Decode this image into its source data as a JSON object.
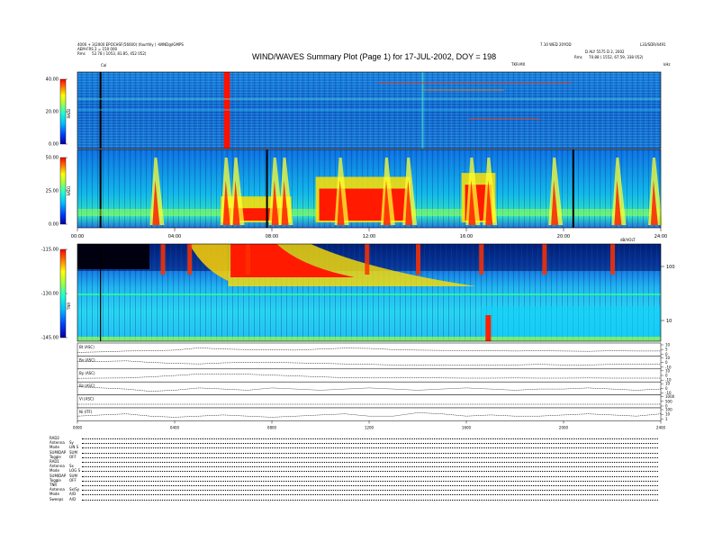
{
  "header": {
    "left_line1": "4000 + 3(2000 EPOCHSF(56000) (fourthly ) -WIND@IGMPS",
    "left_line2": "AEM-FRS 2 = 150 000",
    "left_rms_label": "Rms",
    "left_rms_value": "52.78 ( 1053, 81.85, 452 052)",
    "title": "WIND/WAVES Summary Plot (Page 1) for 17-JUL-2002, DOY = 198",
    "right_line1": "7.10 WED 20YOD",
    "right_corner": "L33/SDR/4491",
    "right_line2": "D ALY 5575 D 2, 2002",
    "right_rms_label": "Rms",
    "right_rms_value": "70.88 ( 1552, 67.59, 338 052)",
    "cal_label": "Cal",
    "thmx_label": "TKR-MX",
    "khz_label": "kHz"
  },
  "chart_data": [
    {
      "type": "heatmap",
      "panel": "RAD2",
      "ylabel": "RAD2",
      "colorbar_ticks": [
        "40.00",
        "20.00",
        "0.00"
      ],
      "colorbar_range": [
        0,
        40
      ],
      "colormap": [
        "#0000a0",
        "#0040ff",
        "#00c0ff",
        "#20ffd0",
        "#a0ff40",
        "#ffff00",
        "#ff8000",
        "#ff0000"
      ],
      "events_hours": [
        6.1,
        6.2,
        14.2
      ],
      "cal_hour": 0.95
    },
    {
      "type": "heatmap",
      "panel": "RAD1",
      "ylabel": "RAD1",
      "colorbar_ticks": [
        "50.00",
        "25.00",
        "0.00"
      ],
      "colorbar_range": [
        0,
        50
      ],
      "x_ticks": [
        "00:00",
        "04:00",
        "08:00",
        "12:00",
        "16:00",
        "20:00",
        "24:00"
      ],
      "xlim_hours": [
        0,
        24
      ],
      "events_hours": [
        3.2,
        6.1,
        6.5,
        8.1,
        8.5,
        10.8,
        12.7,
        13.6,
        16.2,
        16.9,
        19.6,
        22.2,
        23.7
      ]
    },
    {
      "type": "heatmap",
      "panel": "TNR",
      "ylabel": "TNR",
      "colorbar_ticks": [
        "-115.00",
        "-130.00",
        "-145.00"
      ],
      "colorbar_range": [
        -145,
        -115
      ],
      "right_ticks": [
        "100",
        "10"
      ],
      "corner_label": "dB/VOLT",
      "events_hours": [
        3.5,
        4.6,
        7.0,
        11.9,
        14.0,
        16.6,
        19.2,
        22.0
      ]
    },
    {
      "type": "line",
      "panels": [
        {
          "name": "Bt (ASC)",
          "ticks": [
            "10",
            "5",
            "0"
          ],
          "values": [
            4.0,
            4.2,
            4.5,
            4.6,
            4.8,
            5.6,
            5.2,
            5.0,
            4.9,
            4.8,
            5.2,
            5.5,
            5.4,
            5.0,
            4.8,
            4.7,
            4.7,
            4.6,
            4.5,
            4.6,
            4.5,
            4.4,
            4.6,
            4.5,
            4.5
          ]
        },
        {
          "name": "Bx (ASC)",
          "ticks": [
            "10",
            "0",
            "-10"
          ],
          "values": [
            0.5,
            0.5,
            0.6,
            0.3,
            0.1,
            0.0,
            0.2,
            0.3,
            0.3,
            0.2,
            0.1,
            0.0,
            -0.1,
            -0.2,
            -0.2,
            -0.2,
            -0.3,
            -0.2,
            -0.2,
            -0.1,
            -0.2,
            -0.2,
            -0.1,
            -0.1,
            -0.1
          ]
        },
        {
          "name": "By (ASC)",
          "ticks": [
            "10",
            "0",
            "-10"
          ],
          "values": [
            -0.5,
            -0.4,
            -0.3,
            0.2,
            0.8,
            1.5,
            1.6,
            1.4,
            1.0,
            0.6,
            0.2,
            -0.2,
            -0.3,
            -0.3,
            -0.2,
            -0.3,
            -0.4,
            -0.4,
            -0.3,
            -0.4,
            -0.4,
            -0.3,
            -0.4,
            -0.4,
            -0.4
          ]
        },
        {
          "name": "Bz (ASC)",
          "ticks": [
            "10",
            "0",
            "-10"
          ],
          "values": [
            0.2,
            0.1,
            0.0,
            -0.2,
            -0.1,
            0.1,
            0.0,
            -0.1,
            0.1,
            0.0,
            -0.1,
            0.0,
            0.1,
            0.0,
            -0.1,
            0.0,
            0.1,
            0.0,
            -0.1,
            0.0,
            0.0,
            0.1,
            0.0,
            -0.1,
            0.0
          ]
        },
        {
          "name": "Vi (ASC)",
          "ticks": [
            "1000",
            "500",
            "0"
          ],
          "values": [
            0,
            0,
            0,
            0,
            0,
            0,
            0,
            0,
            0,
            0,
            0,
            0,
            0,
            0,
            0,
            0,
            0,
            0,
            0,
            0,
            0,
            0,
            0,
            0,
            0
          ]
        },
        {
          "name": "Ni (ITF)",
          "ticks": [
            "100",
            "10",
            "1"
          ],
          "values": [
            9.0,
            9.1,
            9.2,
            9.0,
            8.9,
            9.0,
            9.1,
            9.0,
            8.9,
            9.0,
            9.1,
            9.2,
            9.0,
            9.0,
            9.3,
            9.2,
            9.0,
            9.1,
            9.0,
            9.0,
            9.1,
            9.2,
            9.1,
            9.0,
            9.2
          ]
        }
      ],
      "x_ticks": [
        "0000",
        "0400",
        "0800",
        "1200",
        "1600",
        "2000",
        "2400"
      ],
      "xlim_hours": [
        0,
        24
      ]
    }
  ],
  "footer": {
    "lines": [
      [
        "RAD2",
        ""
      ],
      [
        "Antenna",
        "Sy"
      ],
      [
        "Mode",
        "LIN S"
      ],
      [
        "SUMIDAP",
        "SUM"
      ],
      [
        "Toggle",
        "OFF"
      ],
      [
        "RAD1",
        ""
      ],
      [
        "Antenna",
        "Sx"
      ],
      [
        "Mode",
        "LOG S"
      ],
      [
        "SUMIDAP",
        "SUM"
      ],
      [
        "Toggle",
        "OFF"
      ],
      [
        "TNR",
        ""
      ],
      [
        "Antenna",
        "Sx/Sy"
      ],
      [
        "Mode",
        "A/D"
      ],
      [
        "Sweeps",
        "A/D"
      ]
    ]
  }
}
